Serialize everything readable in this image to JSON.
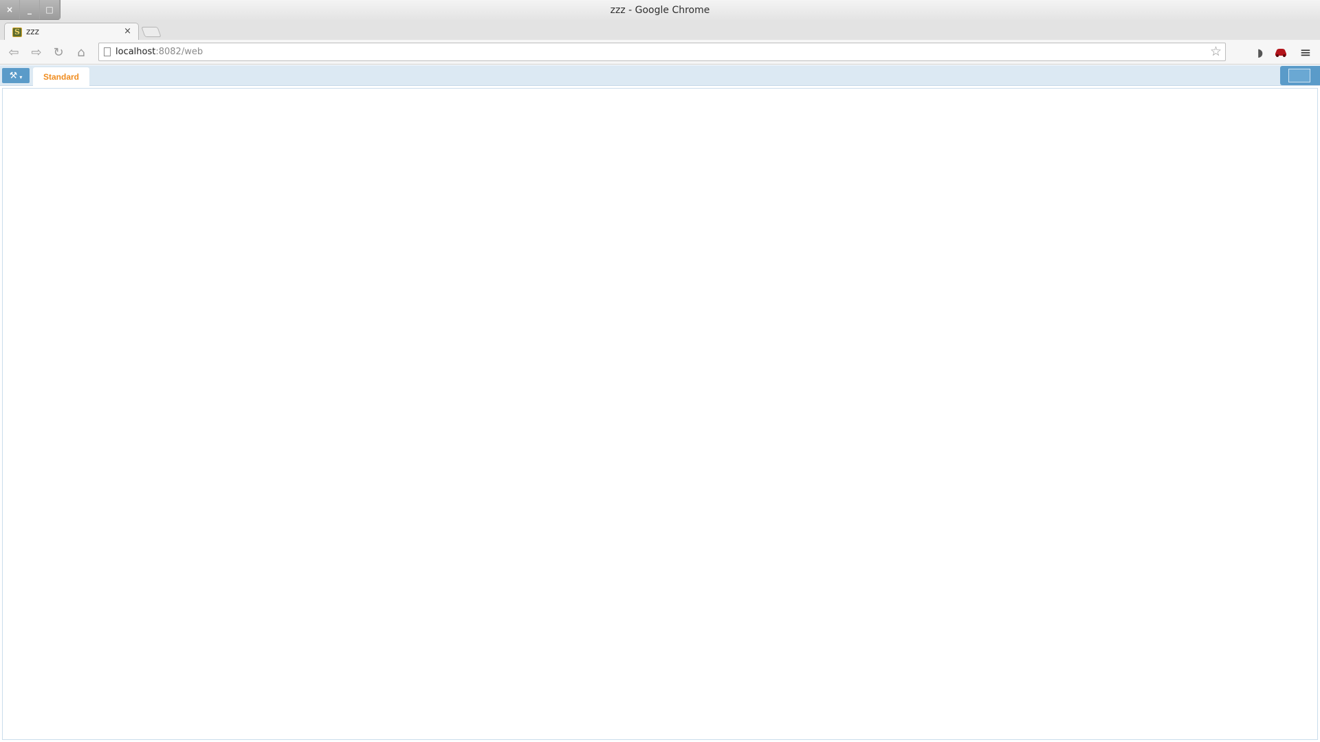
{
  "window": {
    "title": "zzz - Google Chrome",
    "controls": {
      "close": "×",
      "minimize": "_",
      "maximize": "□"
    }
  },
  "tabs": [
    {
      "title": "zzz",
      "favicon": "S",
      "close": "×"
    }
  ],
  "toolbar": {
    "back_icon": "⇦",
    "forward_icon": "⇨",
    "reload_icon": "↻",
    "home_icon": "⌂",
    "url_host": "localhost",
    "url_rest": ":8082/web",
    "bookmark_icon": "☆",
    "extensions": [
      {
        "name": "broadcast-icon",
        "glyph": "◗"
      },
      {
        "name": "car-icon",
        "glyph": "🚗",
        "color": "#b3141b"
      }
    ],
    "menu_icon": "≡"
  },
  "app": {
    "tools_icon": "⚒",
    "tools_caret": "▾",
    "active_tab": "Standard",
    "accent": "#5a9bc9",
    "tab_text_color": "#f08c1e"
  }
}
